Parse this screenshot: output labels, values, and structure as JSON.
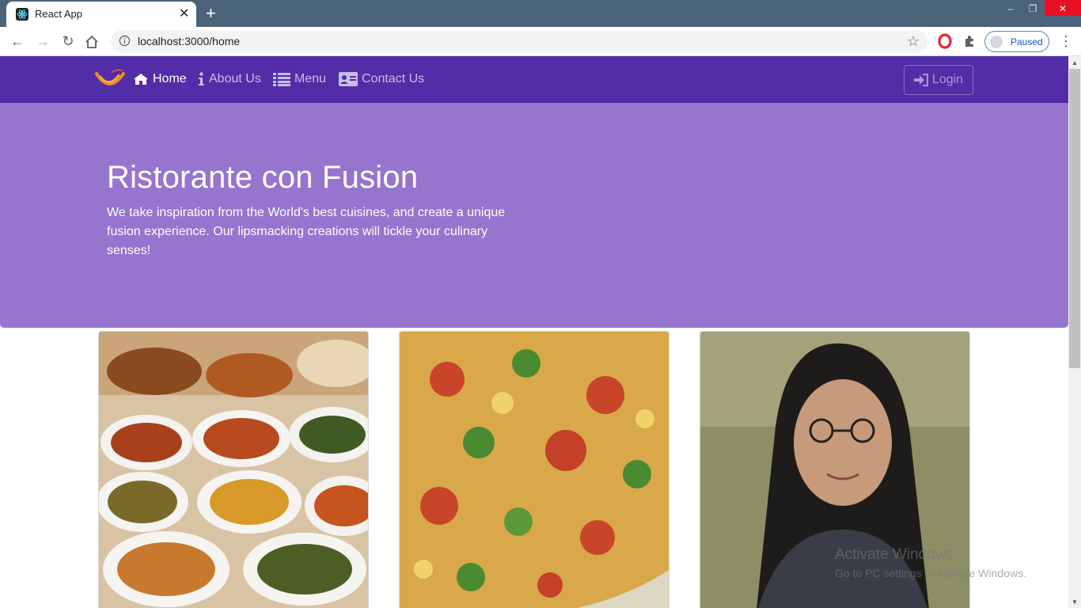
{
  "browser": {
    "tab_title": "React App",
    "url": "localhost:3000/home",
    "profile_label": "Paused"
  },
  "navbar": {
    "links": [
      {
        "label": "Home",
        "icon": "home-icon",
        "active": true
      },
      {
        "label": "About Us",
        "icon": "info-icon",
        "active": false
      },
      {
        "label": "Menu",
        "icon": "list-icon",
        "active": false
      },
      {
        "label": "Contact Us",
        "icon": "address-card-icon",
        "active": false
      }
    ],
    "login_label": "Login"
  },
  "jumbotron": {
    "title": "Ristorante con Fusion",
    "text": "We take inspiration from the World's best cuisines, and create a unique fusion experience. Our lipsmacking creations will tickle your culinary senses!"
  },
  "cards": [
    {
      "image": "buffet-dishes"
    },
    {
      "image": "pizza"
    },
    {
      "image": "person-portrait"
    }
  ],
  "watermark": {
    "line1": "Activate Windows",
    "line2": "Go to PC settings to activate Windows."
  },
  "colors": {
    "navbar": "#512da8",
    "jumbotron": "#9575cd",
    "tabstrip": "#4b6378"
  }
}
